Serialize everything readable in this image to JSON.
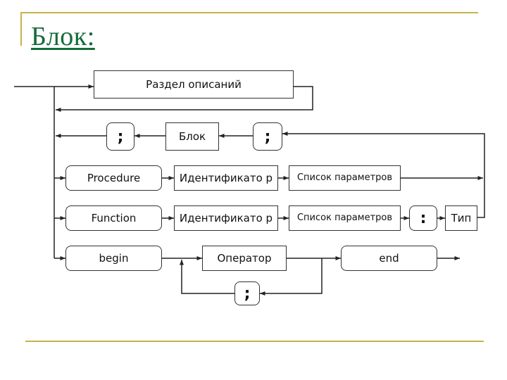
{
  "slide": {
    "title": "Блок:",
    "accent_color": "#146b3a",
    "frame_color": "#c9b24a"
  },
  "diagram": {
    "type": "syntax-diagram",
    "subject": "Блок",
    "nodes": {
      "declarations": "Раздел описаний",
      "semicolon_left": ";",
      "block": "Блок",
      "semicolon_right": ";",
      "procedure": "Procedure",
      "proc_identifier": "Идентификато р",
      "proc_params": "Список параметров",
      "function": "Function",
      "func_identifier": "Идентификато р",
      "func_params": "Список параметров",
      "colon": ":",
      "type": "Тип",
      "begin": "begin",
      "operator": "Оператор",
      "end": "end",
      "operator_separator": ";"
    },
    "edges": [
      [
        "entry",
        "declarations"
      ],
      [
        "declarations",
        "junction"
      ],
      [
        "junction",
        "procedure"
      ],
      [
        "junction",
        "function"
      ],
      [
        "junction",
        "begin"
      ],
      [
        "procedure",
        "proc_identifier"
      ],
      [
        "proc_identifier",
        "proc_params"
      ],
      [
        "proc_params",
        "semicolon_right"
      ],
      [
        "function",
        "func_identifier"
      ],
      [
        "func_identifier",
        "func_params"
      ],
      [
        "func_params",
        "colon"
      ],
      [
        "colon",
        "type"
      ],
      [
        "type",
        "semicolon_right"
      ],
      [
        "semicolon_right",
        "block"
      ],
      [
        "block",
        "semicolon_left"
      ],
      [
        "semicolon_left",
        "junction"
      ],
      [
        "begin",
        "operator"
      ],
      [
        "operator",
        "end"
      ],
      [
        "operator",
        "operator_separator"
      ],
      [
        "operator_separator",
        "operator"
      ],
      [
        "end",
        "exit"
      ]
    ]
  }
}
